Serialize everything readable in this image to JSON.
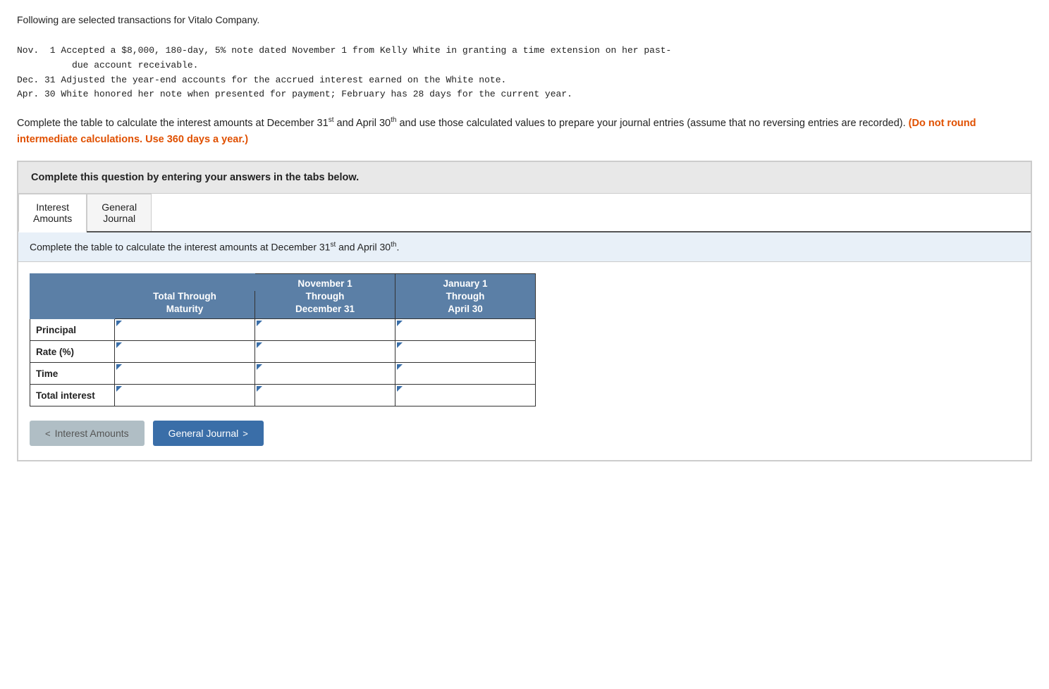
{
  "intro": {
    "line1": "Following are selected transactions for Vitalo Company.",
    "transactions": "Nov.  1 Accepted a $8,000, 180-day, 5% note dated November 1 from Kelly White in granting a time extension on her past-\n          due account receivable.\nDec. 31 Adjusted the year-end accounts for the accrued interest earned on the White note.\nApr. 30 White honored her note when presented for payment; February has 28 days for the current year."
  },
  "instruction": {
    "text": "Complete the table to calculate the interest amounts at December 31",
    "sup1": "st",
    "mid": " and April 30",
    "sup2": "th",
    "end": " and use those calculated values to prepare your journal entries (assume that no reversing entries are recorded).",
    "highlight": " (Do not round intermediate calculations. Use 360 days a year.)"
  },
  "complete_box": {
    "label": "Complete this question by entering your answers in the tabs below."
  },
  "tabs": [
    {
      "id": "interest-amounts",
      "label_line1": "Interest",
      "label_line2": "Amounts",
      "active": true
    },
    {
      "id": "general-journal",
      "label_line1": "General",
      "label_line2": "Journal",
      "active": false
    }
  ],
  "tab_instruction": {
    "text": "Complete the table to calculate the interest amounts at December 31",
    "sup1": "st",
    "mid": " and April 30",
    "sup2": "th",
    "end": "."
  },
  "table": {
    "headers": {
      "col1_label": "",
      "col2_top": "",
      "col2_mid": "Total Through",
      "col2_bot": "Maturity",
      "col3_top": "November 1",
      "col3_mid": "Through",
      "col3_bot": "December 31",
      "col4_top": "January 1",
      "col4_mid": "Through",
      "col4_bot": "April 30"
    },
    "rows": [
      {
        "label": "Principal"
      },
      {
        "label": "Rate (%)"
      },
      {
        "label": "Time"
      },
      {
        "label": "Total interest"
      }
    ]
  },
  "navigation": {
    "prev_label": "Interest Amounts",
    "next_label": "General Journal"
  }
}
